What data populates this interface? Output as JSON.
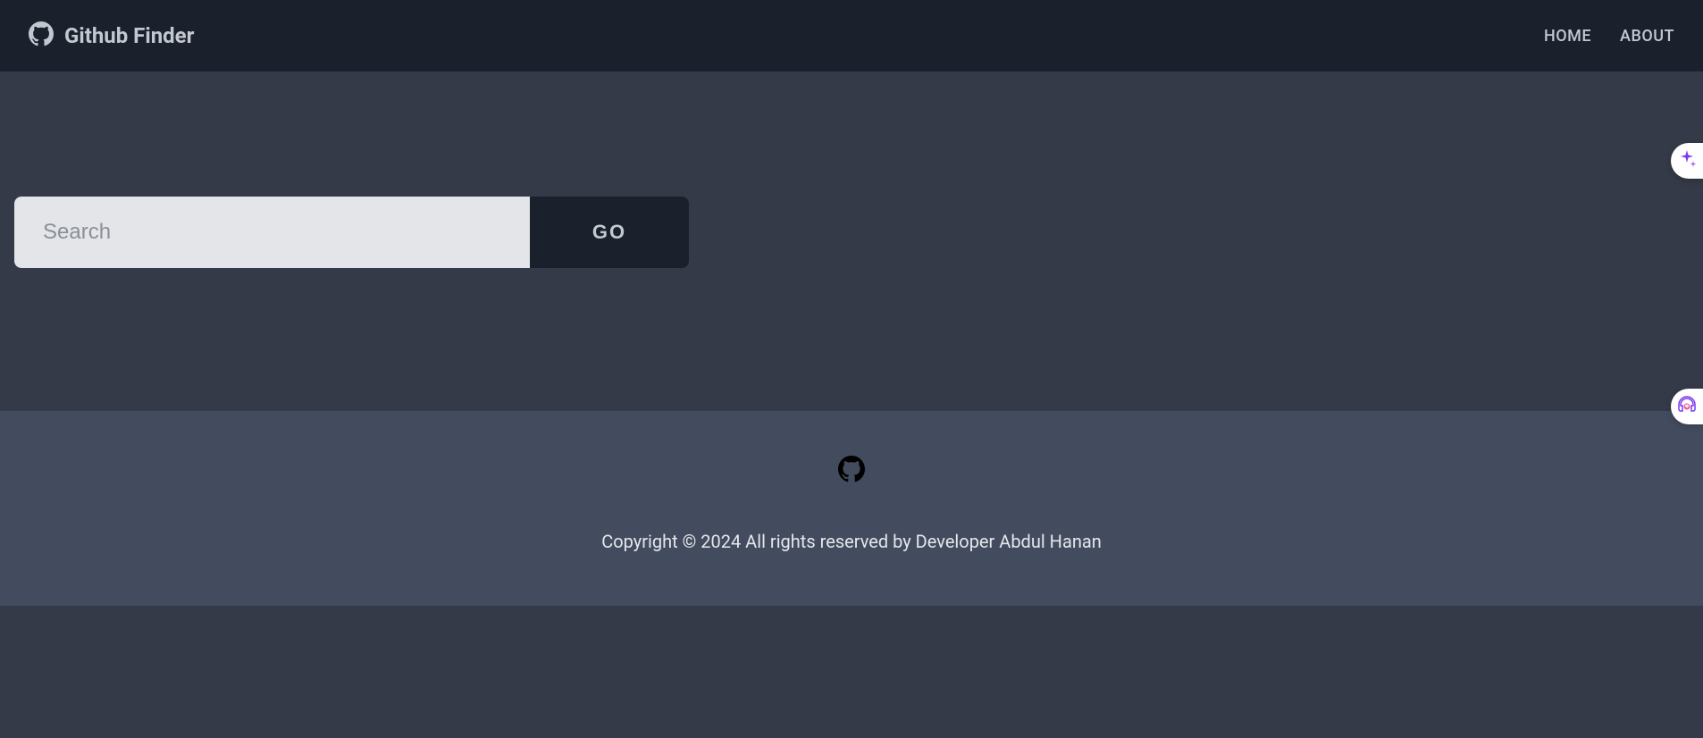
{
  "navbar": {
    "title": "Github Finder",
    "links": [
      {
        "label": "HOME"
      },
      {
        "label": "ABOUT"
      }
    ]
  },
  "search": {
    "placeholder": "Search",
    "value": "",
    "button_label": "GO"
  },
  "footer": {
    "copyright": "Copyright © 2024 All rights reserved by Developer Abdul Hanan"
  }
}
